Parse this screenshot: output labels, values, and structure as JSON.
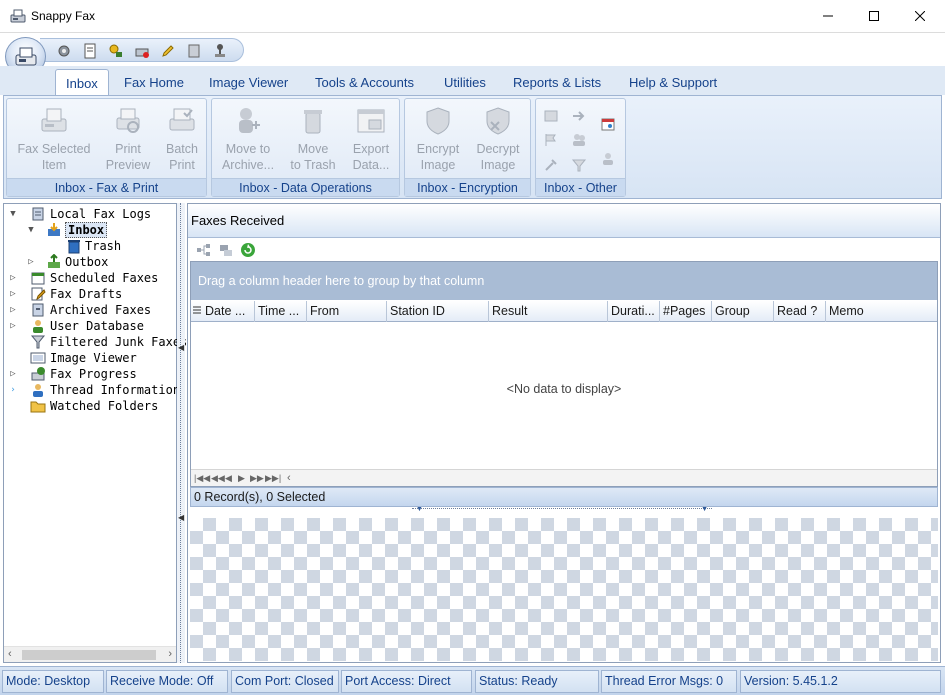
{
  "window": {
    "title": "Snappy Fax"
  },
  "tabs": [
    {
      "label": "Inbox",
      "active": true
    },
    {
      "label": "Fax Home"
    },
    {
      "label": "Image Viewer"
    },
    {
      "label": "Tools & Accounts"
    },
    {
      "label": "Utilities"
    },
    {
      "label": "Reports & Lists"
    },
    {
      "label": "Help & Support"
    }
  ],
  "ribbon": {
    "groups": [
      {
        "label": "Inbox - Fax & Print",
        "buttons": [
          {
            "line1": "Fax Selected",
            "line2": "Item",
            "icon": "fax-machine-icon"
          },
          {
            "line1": "Print",
            "line2": "Preview",
            "icon": "print-preview-icon"
          },
          {
            "line1": "Batch",
            "line2": "Print",
            "icon": "batch-print-icon"
          }
        ]
      },
      {
        "label": "Inbox - Data Operations",
        "buttons": [
          {
            "line1": "Move to",
            "line2": "Archive...",
            "icon": "archive-user-icon"
          },
          {
            "line1": "Move",
            "line2": "to Trash",
            "icon": "trash-can-icon"
          },
          {
            "line1": "Export",
            "line2": "Data...",
            "icon": "export-window-icon"
          }
        ]
      },
      {
        "label": "Inbox - Encryption",
        "buttons": [
          {
            "line1": "Encrypt",
            "line2": "Image",
            "icon": "shield-icon"
          },
          {
            "line1": "Decrypt",
            "line2": "Image",
            "icon": "shield-x-icon"
          }
        ]
      },
      {
        "label": "Inbox - Other"
      }
    ]
  },
  "tree": {
    "items": [
      {
        "label": "Local Fax Logs",
        "icon": "database-icon",
        "expanded": true
      },
      {
        "label": "Inbox",
        "icon": "inbox-icon",
        "expanded": true,
        "selected": true
      },
      {
        "label": "Trash",
        "icon": "trash-icon"
      },
      {
        "label": "Outbox",
        "icon": "outbox-icon"
      },
      {
        "label": "Scheduled Faxes",
        "icon": "calendar-icon"
      },
      {
        "label": "Fax Drafts",
        "icon": "draft-pencil-icon"
      },
      {
        "label": "Archived Faxes",
        "icon": "archive-icon"
      },
      {
        "label": "User Database",
        "icon": "user-icon"
      },
      {
        "label": "Filtered Junk Faxes",
        "icon": "funnel-icon"
      },
      {
        "label": "Image Viewer",
        "icon": "image-viewer-icon"
      },
      {
        "label": "Fax Progress",
        "icon": "fax-progress-icon"
      },
      {
        "label": "Thread Information",
        "icon": "thread-user-icon"
      },
      {
        "label": "Watched Folders",
        "icon": "folder-icon"
      }
    ]
  },
  "pane": {
    "title": "Faxes Received",
    "group_hint": "Drag a column header here to group by that column",
    "columns": [
      "Date ...",
      "Time ...",
      "From",
      "Station ID",
      "Result",
      "Durati...",
      "#Pages",
      "Group",
      "Read ?",
      "Memo"
    ],
    "empty_text": "<No data to display>",
    "record_status": "0 Record(s), 0 Selected"
  },
  "statusbar": [
    "Mode: Desktop",
    "Receive Mode: Off",
    "Com Port: Closed",
    "Port Access: Direct",
    "Status: Ready",
    "Thread Error Msgs: 0",
    "Version: 5.45.1.2"
  ],
  "colors": {
    "accent": "#15428b",
    "ribbon_bg": "#dfe9f5",
    "group_panel": "#a9bcd5"
  }
}
